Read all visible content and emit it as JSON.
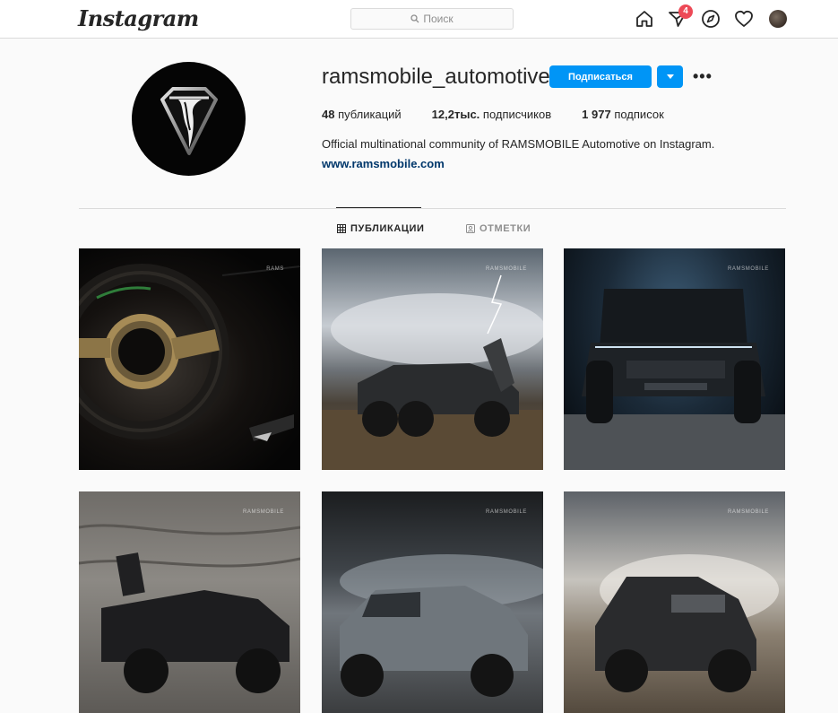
{
  "nav": {
    "logo": "Instagram",
    "search_placeholder": "Поиск",
    "activity_badge": "4",
    "icons": [
      "home-icon",
      "direct-icon",
      "explore-icon",
      "heart-icon",
      "profile-avatar"
    ]
  },
  "profile": {
    "username": "ramsmobile_automotive",
    "follow_label": "Подписаться",
    "more_label": "•••",
    "stats": [
      {
        "value": "48",
        "label": "публикаций"
      },
      {
        "value": "12,2тыс.",
        "label": "подписчиков"
      },
      {
        "value": "1 977",
        "label": "подписок"
      }
    ],
    "bio": "Official multinational community of RAMSMOBILE Automotive on Instagram.",
    "website": "www.ramsmobile.com"
  },
  "tabs": [
    {
      "label": "ПУБЛИКАЦИИ",
      "icon": "grid-icon",
      "active": true
    },
    {
      "label": "ОТМЕТКИ",
      "icon": "tagged-icon",
      "active": false
    }
  ],
  "posts": [
    {
      "watermark": "RAMS"
    },
    {
      "watermark": "RAMSMOBILE"
    },
    {
      "watermark": "RAMSMOBILE"
    },
    {
      "watermark": "RAMSMOBILE"
    },
    {
      "watermark": "RAMSMOBILE"
    },
    {
      "watermark": "RAMSMOBILE"
    }
  ],
  "colors": {
    "accent": "#0095f6",
    "badge": "#ed4956",
    "link": "#00376b"
  }
}
